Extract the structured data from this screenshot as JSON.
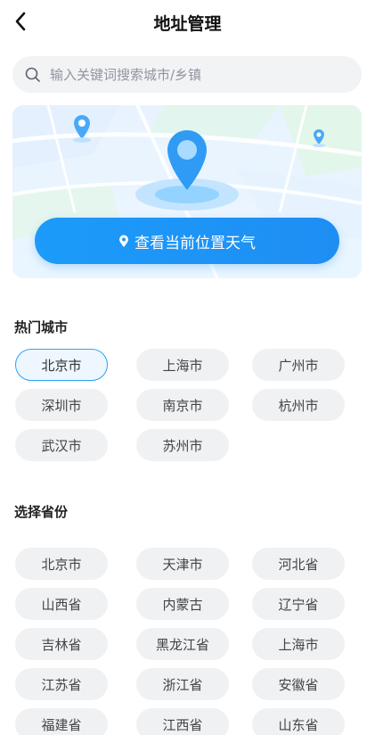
{
  "header": {
    "title": "地址管理",
    "back_icon": "chevron-left-icon"
  },
  "search": {
    "placeholder": "输入关键词搜索城市/乡镇",
    "icon": "search-icon"
  },
  "map_card": {
    "locate_button_label": "查看当前位置天气",
    "locate_icon": "location-pin-icon",
    "colors": {
      "button": "#1c9bfa",
      "pin": "#3aa3f8"
    }
  },
  "hot_cities": {
    "title": "热门城市",
    "selected": "北京市",
    "items": [
      "北京市",
      "上海市",
      "广州市",
      "深圳市",
      "南京市",
      "杭州市",
      "武汉市",
      "苏州市"
    ]
  },
  "provinces": {
    "title": "选择省份",
    "items": [
      "北京市",
      "天津市",
      "河北省",
      "山西省",
      "内蒙古",
      "辽宁省",
      "吉林省",
      "黑龙江省",
      "上海市",
      "江苏省",
      "浙江省",
      "安徽省",
      "福建省",
      "江西省",
      "山东省"
    ]
  }
}
